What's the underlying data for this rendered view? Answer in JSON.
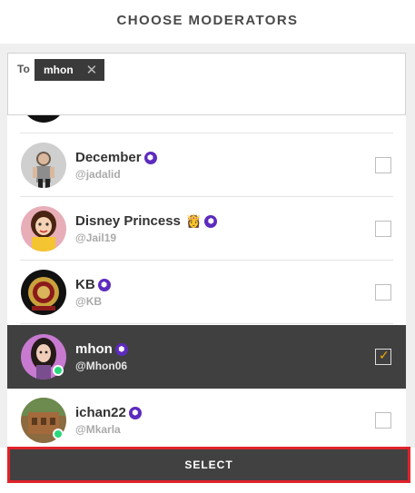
{
  "header": {
    "title": "CHOOSE MODERATORS"
  },
  "recipients": {
    "to_label": "To",
    "chips": [
      {
        "label": "mhon"
      }
    ]
  },
  "users": [
    {
      "name": "December",
      "handle": "@jadalid",
      "vip": true,
      "emoji": "",
      "selected": false,
      "online": false
    },
    {
      "name": "Disney Princess",
      "handle": "@Jail19",
      "vip": true,
      "emoji": "👸",
      "selected": false,
      "online": false
    },
    {
      "name": "KB",
      "handle": "@KB",
      "vip": true,
      "emoji": "",
      "selected": false,
      "online": false
    },
    {
      "name": "mhon",
      "handle": "@Mhon06",
      "vip": true,
      "emoji": "",
      "selected": true,
      "online": true
    },
    {
      "name": "ichan22",
      "handle": "@Mkarla",
      "vip": true,
      "emoji": "",
      "selected": false,
      "online": true
    }
  ],
  "footer": {
    "select_label": "SELECT"
  },
  "colors": {
    "selected_row": "#404040",
    "vip_badge": "#5d2bbd",
    "online": "#27d97b",
    "highlight_border": "#e0232a",
    "checkmark": "#f2a900"
  }
}
